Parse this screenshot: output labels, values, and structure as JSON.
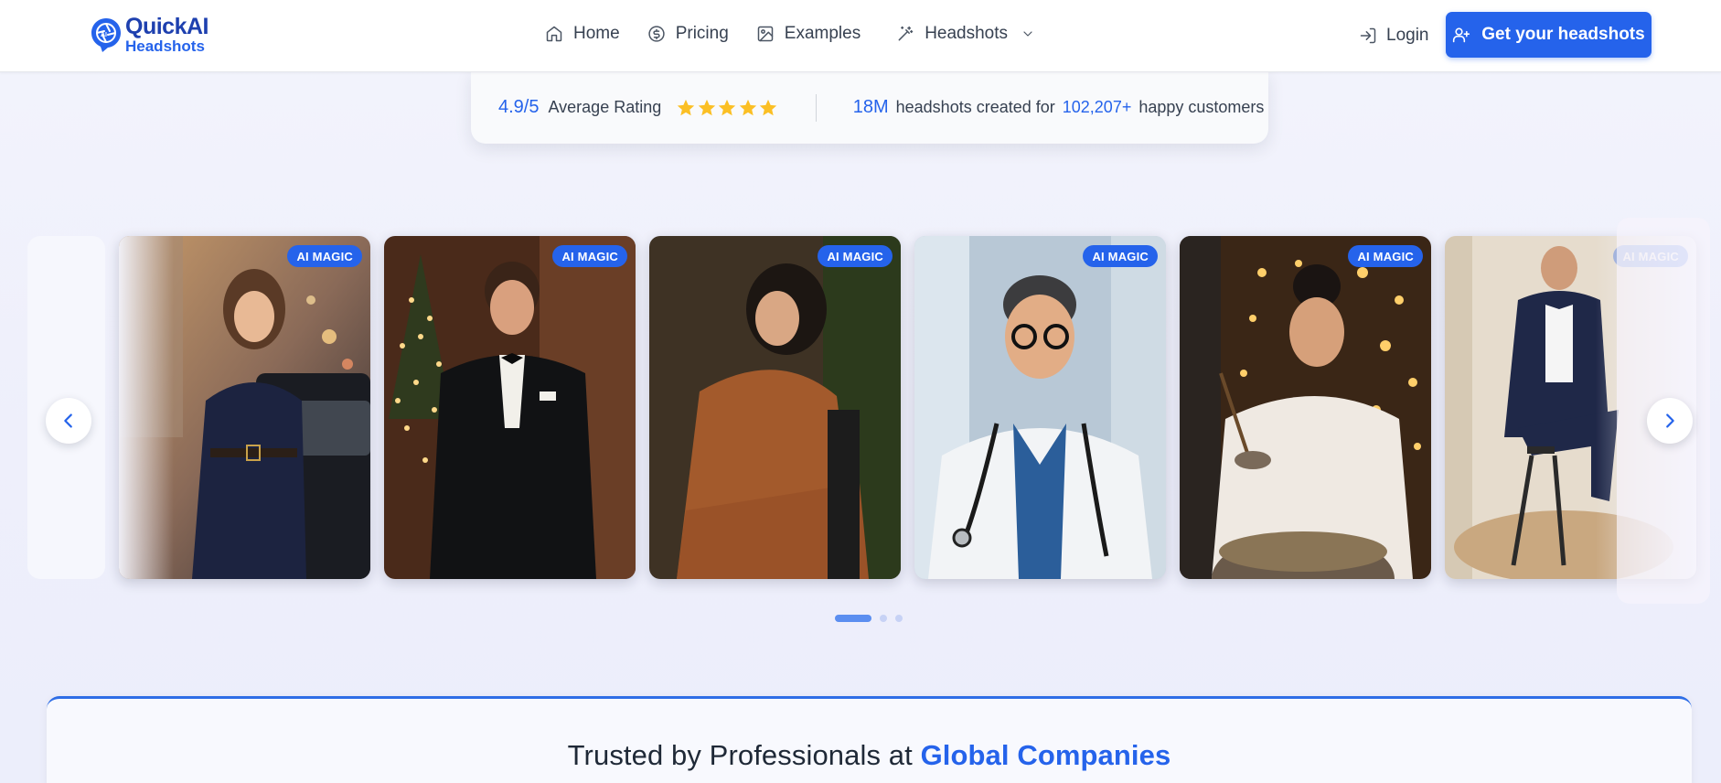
{
  "header": {
    "logo": {
      "line1": "QuickAI",
      "line2": "Headshots"
    },
    "nav": [
      {
        "label": "Home",
        "icon": "home-icon"
      },
      {
        "label": "Pricing",
        "icon": "dollar-circle-icon"
      },
      {
        "label": "Examples",
        "icon": "image-icon"
      },
      {
        "label": "Headshots",
        "icon": "magic-wand-icon",
        "dropdown": true
      }
    ],
    "login_label": "Login",
    "cta_label": "Get your headshots"
  },
  "rating": {
    "score": "4.9/5",
    "score_text": "Average Rating",
    "stars": 5,
    "headshots_count": "18M",
    "headshots_text": "headshots created for",
    "customers_count": "102,207+",
    "customers_text": "happy customers"
  },
  "carousel": {
    "badge_label": "AI MAGIC",
    "cards": [
      {
        "subject": "woman in navy coat beside car"
      },
      {
        "subject": "man in tuxedo by christmas tree"
      },
      {
        "subject": "woman in rust suit"
      },
      {
        "subject": "smiling doctor with stethoscope"
      },
      {
        "subject": "chef with ladle"
      },
      {
        "subject": "man in navy suit on stool"
      }
    ],
    "dots": 3,
    "active_dot": 0
  },
  "trusted": {
    "title_prefix": "Trusted by Professionals at",
    "title_highlight": "Global Companies"
  },
  "colors": {
    "accent": "#2563eb",
    "star": "#fbbf24"
  }
}
